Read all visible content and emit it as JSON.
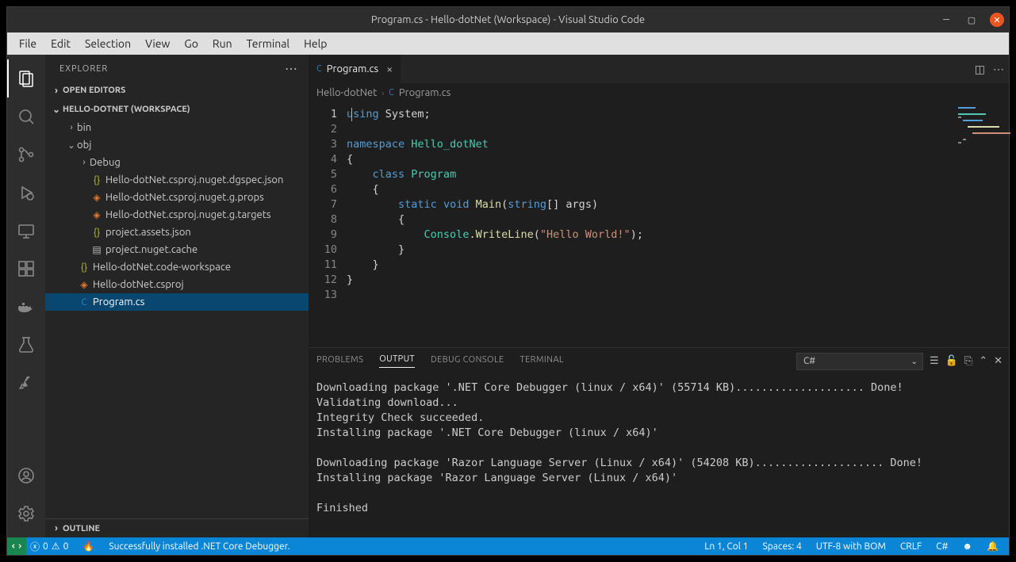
{
  "window": {
    "title": "Program.cs - Hello-dotNet (Workspace) - Visual Studio Code"
  },
  "menu": [
    "File",
    "Edit",
    "Selection",
    "View",
    "Go",
    "Run",
    "Terminal",
    "Help"
  ],
  "sidebar": {
    "title": "EXPLORER",
    "open_editors": "OPEN EDITORS",
    "workspace_label": "HELLO-DOTNET (WORKSPACE)",
    "outline": "OUTLINE",
    "tree": {
      "bin": "bin",
      "obj": "obj",
      "debug": "Debug",
      "dgspec": "Hello-dotNet.csproj.nuget.dgspec.json",
      "gprops": "Hello-dotNet.csproj.nuget.g.props",
      "gtargets": "Hello-dotNet.csproj.nuget.g.targets",
      "assets": "project.assets.json",
      "nucache": "project.nuget.cache",
      "codews": "Hello-dotNet.code-workspace",
      "csproj": "Hello-dotNet.csproj",
      "program": "Program.cs"
    }
  },
  "editor": {
    "tab_label": "Program.cs",
    "breadcrumb_folder": "Hello-dotNet",
    "breadcrumb_file": "Program.cs",
    "lines": {
      "l1": {
        "kw1": "using",
        "rest": " System;"
      },
      "l3": {
        "kw": "namespace",
        "cls": "Hello_dotNet"
      },
      "l4": "{",
      "l5": {
        "kw": "class",
        "cls": "Program"
      },
      "l6": "    {",
      "l7": {
        "kw1": "static",
        "kw2": "void",
        "fn": "Main",
        "open": "(",
        "kw3": "string",
        "arr": "[] args",
        ")": ")"
      },
      "l8": "        {",
      "l9": {
        "cls": "Console",
        ".": ".",
        "fn": "WriteLine",
        "open": "(",
        "str": "\"Hello World!\"",
        "close": ");"
      },
      "l10": "        }",
      "l11": "    }",
      "l12": "}"
    }
  },
  "panel": {
    "tabs": {
      "problems": "PROBLEMS",
      "output": "OUTPUT",
      "debug": "DEBUG CONSOLE",
      "terminal": "TERMINAL"
    },
    "select_value": "C#",
    "output": "Downloading package '.NET Core Debugger (linux / x64)' (55714 KB).................... Done!\nValidating download...\nIntegrity Check succeeded.\nInstalling package '.NET Core Debugger (linux / x64)'\n\nDownloading package 'Razor Language Server (Linux / x64)' (54208 KB).................... Done!\nInstalling package 'Razor Language Server (Linux / x64)'\n\nFinished"
  },
  "status": {
    "errors": "0",
    "warnings": "0",
    "message": "Successfully installed .NET Core Debugger.",
    "ln_col": "Ln 1, Col 1",
    "spaces": "Spaces: 4",
    "encoding": "UTF-8 with BOM",
    "eol": "CRLF",
    "language": "C#"
  }
}
